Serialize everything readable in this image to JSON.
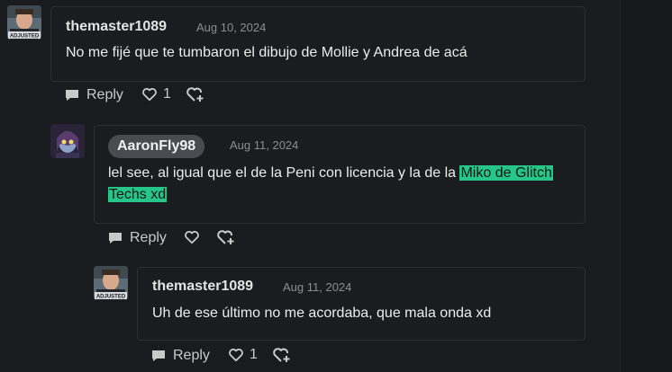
{
  "comments": [
    {
      "username": "themaster1089",
      "avatar_badge": "ADJUSTED",
      "date": "Aug 10, 2024",
      "text": "No me fijé que te tumbaron el dibujo de Mollie y Andrea de acá",
      "reply_label": "Reply",
      "like_count": "1"
    },
    {
      "username": "AaronFly98",
      "date": "Aug 11, 2024",
      "text_before": "lel see, al igual que el de la Peni con licencia y la de la ",
      "text_highlight_1": "Miko de Glitch",
      "text_highlight_2": "Techs xd",
      "reply_label": "Reply",
      "like_count": ""
    },
    {
      "username": "themaster1089",
      "avatar_badge": "ADJUSTED",
      "date": "Aug 11, 2024",
      "text": "Uh de ese último no me acordaba, que mala onda xd",
      "reply_label": "Reply",
      "like_count": "1"
    }
  ],
  "icons": {
    "reply": "speech-bubble-icon",
    "like": "heart-icon",
    "award": "heart-plus-icon"
  },
  "colors": {
    "background": "#1a1b1e",
    "highlight": "#27c58a",
    "username_pill": "#4a4b50"
  }
}
